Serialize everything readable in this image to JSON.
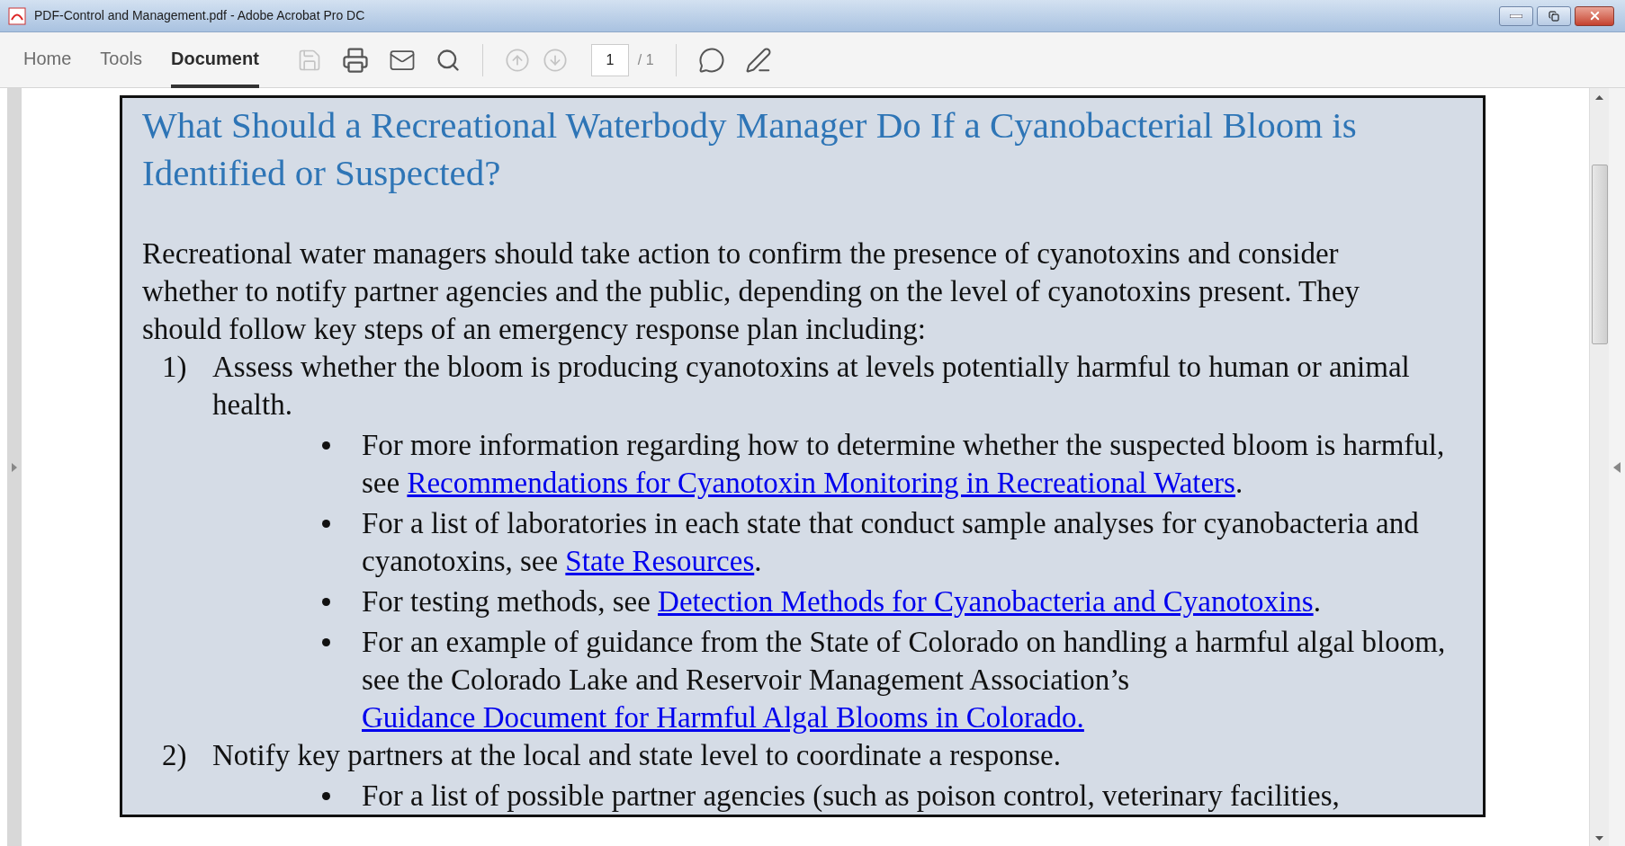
{
  "window": {
    "title": "PDF-Control and Management.pdf - Adobe Acrobat Pro DC"
  },
  "tabs": [
    {
      "label": "Home",
      "selected": false
    },
    {
      "label": "Tools",
      "selected": false
    },
    {
      "label": "Document",
      "selected": true
    }
  ],
  "toolbar": {
    "save_disabled": true,
    "prev_disabled": true,
    "next_disabled": true,
    "page": "1",
    "page_total": "/ 1"
  },
  "document": {
    "heading": "What Should a Recreational Waterbody Manager Do If a Cyanobacterial Bloom is Identified or Suspected?",
    "intro": "Recreational water managers should take action to confirm the presence of cyanotoxins and consider whether to notify partner agencies and the public, depending on the level of cyanotoxins present. They should follow key steps of an emergency response plan including:",
    "steps": [
      {
        "number": "1)",
        "text": "Assess whether the bloom is producing cyanotoxins at levels potentially harmful to human or animal health.",
        "bullets": [
          {
            "before": "For more information regarding how to determine whether the suspected bloom is harmful, see ",
            "link": "Recommendations for Cyanotoxin Monitoring in Recreational Waters",
            "after": "."
          },
          {
            "before": "For a list of laboratories in each state that conduct sample analyses for cyanobacteria and cyanotoxins, see ",
            "link": "State Resources",
            "after": "."
          },
          {
            "before": "For testing methods, see ",
            "link": "Detection Methods for Cyanobacteria and Cyanotoxins",
            "after": "."
          },
          {
            "before": "For an example of guidance from the State of Colorado on handling a harmful algal bloom, see the Colorado Lake and Reservoir Management Association’s ",
            "link": "Guidance Document for Harmful Algal Blooms in Colorado."
          }
        ]
      },
      {
        "number": "2)",
        "text": "Notify key partners at the local and state level to coordinate a response.",
        "bullets": [
          {
            "before": "For a list of possible partner agencies (such as poison control, veterinary facilities,"
          }
        ]
      }
    ]
  }
}
